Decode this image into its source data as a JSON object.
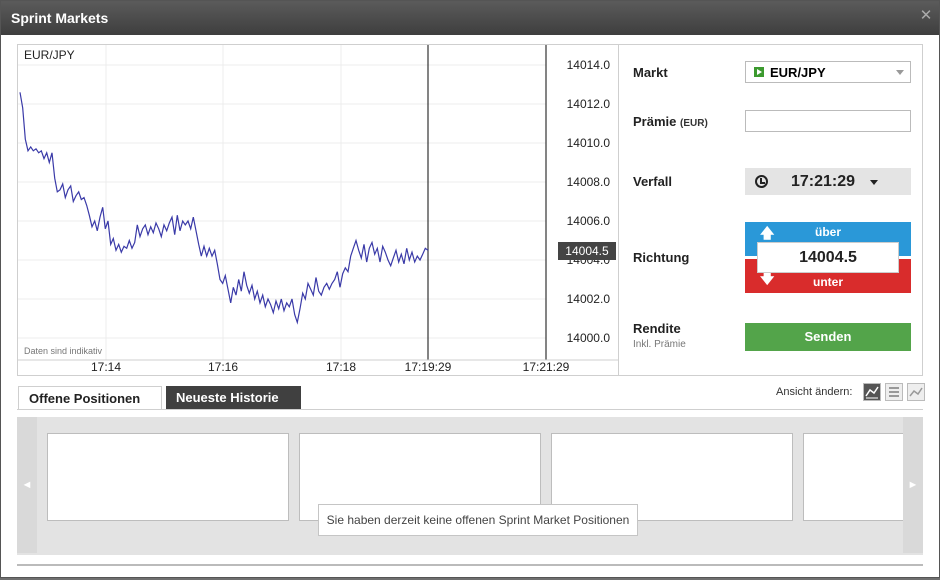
{
  "window": {
    "title": "Sprint Markets",
    "close_icon": "close-icon"
  },
  "chart": {
    "symbol": "EUR/JPY",
    "disclaimer": "Daten sind indikativ",
    "current_price_label": "14004.5"
  },
  "chart_data": {
    "type": "line",
    "title": "",
    "x_labels": [
      "17:14",
      "17:16",
      "17:18",
      "17:19:29",
      "17:21:29"
    ],
    "y_ticks": [
      "14014.0",
      "14012.0",
      "14010.0",
      "14008.0",
      "14006.0",
      "14004.0",
      "14002.0",
      "14000.0"
    ],
    "ylim": [
      14000.0,
      14014.0
    ],
    "current_value": 14004.5,
    "grid": true,
    "series": [
      {
        "values": [
          14012.6,
          14011.8,
          14010.2,
          14009.6,
          14009.8,
          14009.6,
          14009.7,
          14009.5,
          14009.6,
          14009.2,
          14009.5,
          14009.0,
          14009.5,
          14008.2,
          14007.5,
          14007.6,
          14007.9,
          14007.2,
          14007.6,
          14007.8,
          14007.0,
          14007.3,
          14007.5,
          14007.1,
          14007.2,
          14006.8,
          14006.3,
          14005.7,
          14006.0,
          14005.5,
          14006.2,
          14006.7,
          14005.6,
          14006.0,
          14004.8,
          14005.1,
          14004.5,
          14004.8,
          14004.4,
          14004.7,
          14004.6,
          14005.0,
          14004.6,
          14004.9,
          14005.8,
          14005.2,
          14005.6,
          14005.8,
          14005.3,
          14005.7,
          14005.4,
          14005.9,
          14005.6,
          14005.2,
          14005.8,
          14005.5,
          14005.9,
          14006.2,
          14005.3,
          14006.3,
          14005.5,
          14006.0,
          14005.8,
          14006.0,
          14005.6,
          14006.2,
          14005.5,
          14004.8,
          14004.2,
          14004.7,
          14004.2,
          14004.6,
          14004.2,
          14004.5,
          14003.8,
          14003.0,
          14002.8,
          14003.2,
          14002.5,
          14001.8,
          14002.6,
          14002.2,
          14003.0,
          14002.4,
          14003.4,
          14002.7,
          14002.3,
          14002.7,
          14002.0,
          14002.4,
          14001.8,
          14002.2,
          14001.6,
          14002.0,
          14001.7,
          14001.3,
          14001.9,
          14001.5,
          14002.0,
          14001.4,
          14001.8,
          14001.6,
          14002.0,
          14001.2,
          14000.8,
          14001.5,
          14002.3,
          14002.0,
          14002.8,
          14002.5,
          14002.2,
          14003.1,
          14002.4,
          14002.2,
          14002.6,
          14002.8,
          14002.5,
          14002.8,
          14003.0,
          14003.4,
          14002.6,
          14003.3,
          14003.6,
          14003.4,
          14004.2,
          14004.6,
          14005.0,
          14004.5,
          14004.1,
          14004.8,
          14003.9,
          14004.6,
          14004.9,
          14004.3,
          14004.6,
          14003.9,
          14004.7,
          14004.4,
          14004.0,
          14003.7,
          14004.1,
          14004.5,
          14003.9,
          14004.3,
          14003.8,
          14004.6,
          14004.0,
          14004.4,
          14003.9,
          14004.2,
          14004.0,
          14004.3,
          14004.6,
          14004.5
        ]
      }
    ]
  },
  "form": {
    "market_label": "Markt",
    "market_value": "EUR/JPY",
    "premium_label": "Prämie",
    "premium_unit": "(EUR)",
    "premium_value": "",
    "expiry_label": "Verfall",
    "expiry_time": "17:21:29",
    "direction_label": "Richtung",
    "direction_up": "über",
    "direction_value": "14004.5",
    "direction_down": "unter",
    "return_label": "Rendite",
    "return_sublabel": "Inkl. Prämie",
    "send_label": "Senden"
  },
  "positions": {
    "tab_open": "Offene Positionen",
    "tab_history": "Neueste Historie",
    "change_view_label": "Ansicht ändern:",
    "empty_message": "Sie haben derzeit keine offenen Sprint Market Positionen",
    "arrow_left": "◄",
    "arrow_right": "►"
  },
  "colors": {
    "up": "#2a98d8",
    "down": "#d92c2c",
    "send": "#53a44a",
    "line": "#3a3aa8"
  }
}
